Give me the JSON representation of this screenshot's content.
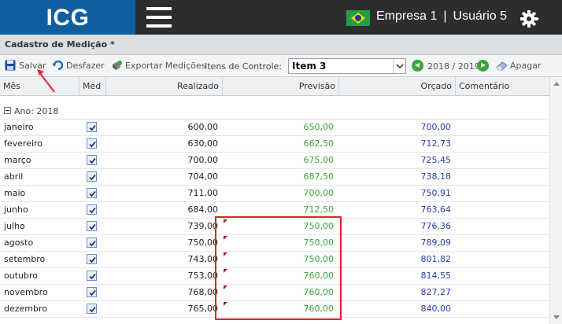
{
  "app": {
    "logo": "ICG",
    "company": "Empresa 1",
    "separator": "|",
    "user": "Usuário 5"
  },
  "page": {
    "title": "Cadastro de Medição *"
  },
  "toolbar": {
    "save_label": "Salvar",
    "undo_label": "Desfazer",
    "export_label": "Exportar Medições",
    "control_items_label": "Itens de Controle:",
    "selected_item": "Item 3",
    "year_range": "2018 / 2019",
    "delete_label": "Apagar"
  },
  "columns": {
    "mes": "Mês",
    "med": "Med",
    "realizado": "Realizado",
    "previsao": "Previsão",
    "orcado": "Orçado",
    "comentario": "Comentário"
  },
  "group": {
    "label": "Ano: 2018"
  },
  "rows": [
    {
      "mes": "janeiro",
      "med": true,
      "realizado": "600,00",
      "previsao": "650,00",
      "orcado": "700,00",
      "flag": false
    },
    {
      "mes": "fevereiro",
      "med": true,
      "realizado": "630,00",
      "previsao": "662,50",
      "orcado": "712,73",
      "flag": false
    },
    {
      "mes": "março",
      "med": true,
      "realizado": "700,00",
      "previsao": "675,00",
      "orcado": "725,45",
      "flag": false
    },
    {
      "mes": "abril",
      "med": true,
      "realizado": "704,00",
      "previsao": "687,50",
      "orcado": "738,18",
      "flag": false
    },
    {
      "mes": "maio",
      "med": true,
      "realizado": "711,00",
      "previsao": "700,00",
      "orcado": "750,91",
      "flag": false
    },
    {
      "mes": "junho",
      "med": true,
      "realizado": "684,00",
      "previsao": "712,50",
      "orcado": "763,64",
      "flag": false
    },
    {
      "mes": "julho",
      "med": true,
      "realizado": "739,00",
      "previsao": "750,00",
      "orcado": "776,36",
      "flag": true
    },
    {
      "mes": "agosto",
      "med": true,
      "realizado": "750,00",
      "previsao": "750,00",
      "orcado": "789,09",
      "flag": true
    },
    {
      "mes": "setembro",
      "med": true,
      "realizado": "743,00",
      "previsao": "750,00",
      "orcado": "801,82",
      "flag": true
    },
    {
      "mes": "outubro",
      "med": true,
      "realizado": "753,00",
      "previsao": "760,00",
      "orcado": "814,55",
      "flag": true
    },
    {
      "mes": "novembro",
      "med": true,
      "realizado": "768,00",
      "previsao": "760,00",
      "orcado": "827,27",
      "flag": true
    },
    {
      "mes": "dezembro",
      "med": true,
      "realizado": "765,00",
      "previsao": "760,00",
      "orcado": "840,00",
      "flag": true
    }
  ],
  "icons": {
    "hamburger": "menu-icon",
    "flag": "brazil-flag-icon",
    "settings": "gear-icon",
    "save": "floppy-disk-icon",
    "undo": "undo-icon",
    "export": "export-icon",
    "prev": "arrow-left-circle-icon",
    "next": "arrow-right-circle-icon",
    "delete": "eraser-icon"
  },
  "colors": {
    "brand": "#0f5fa0",
    "topbar": "#2d2d2d",
    "previsao": "#3aa53a",
    "orcado": "#2f3ea8",
    "annotation": "#e8202a"
  }
}
